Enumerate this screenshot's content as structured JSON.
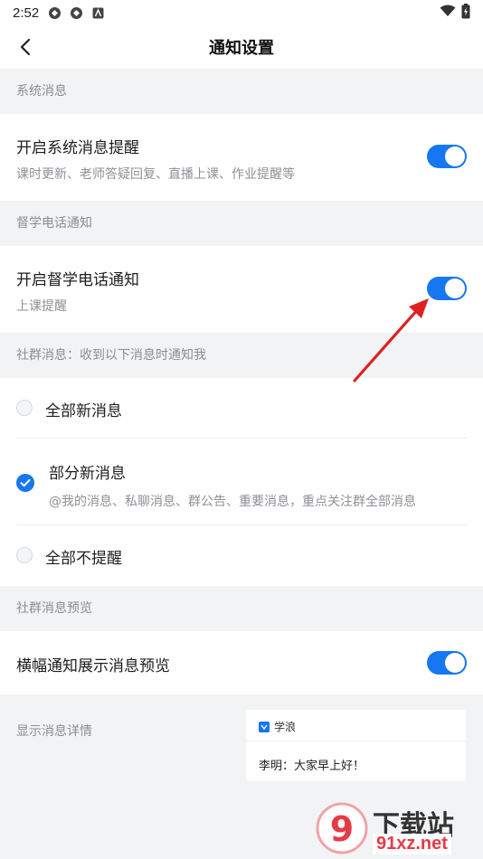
{
  "status_bar": {
    "time": "2:52"
  },
  "nav": {
    "title": "通知设置"
  },
  "sections": {
    "system": "系统消息",
    "phone": "督学电话通知",
    "community": "社群消息：收到以下消息时通知我",
    "preview": "社群消息预览"
  },
  "system_row": {
    "title": "开启系统消息提醒",
    "subtitle": "课时更新、老师答疑回复、直播上课、作业提醒等",
    "enabled": true
  },
  "phone_row": {
    "title": "开启督学电话通知",
    "subtitle": "上课提醒",
    "enabled": true
  },
  "community_options": [
    {
      "label": "全部新消息",
      "checked": false
    },
    {
      "label": "部分新消息",
      "subtitle": "@我的消息、私聊消息、群公告、重要消息，重点关注群全部消息",
      "checked": true
    },
    {
      "label": "全部不提醒",
      "checked": false
    }
  ],
  "banner_row": {
    "title": "横幅通知展示消息预览",
    "enabled": true
  },
  "detail_label": "显示消息详情",
  "preview_card": {
    "app_name": "学浪",
    "message": "李明：大家早上好！"
  },
  "watermark": {
    "brand": "下载站",
    "url": "91xz.net",
    "glyph": "9"
  },
  "colors": {
    "accent": "#1677f0",
    "arrow": "#e02020"
  }
}
